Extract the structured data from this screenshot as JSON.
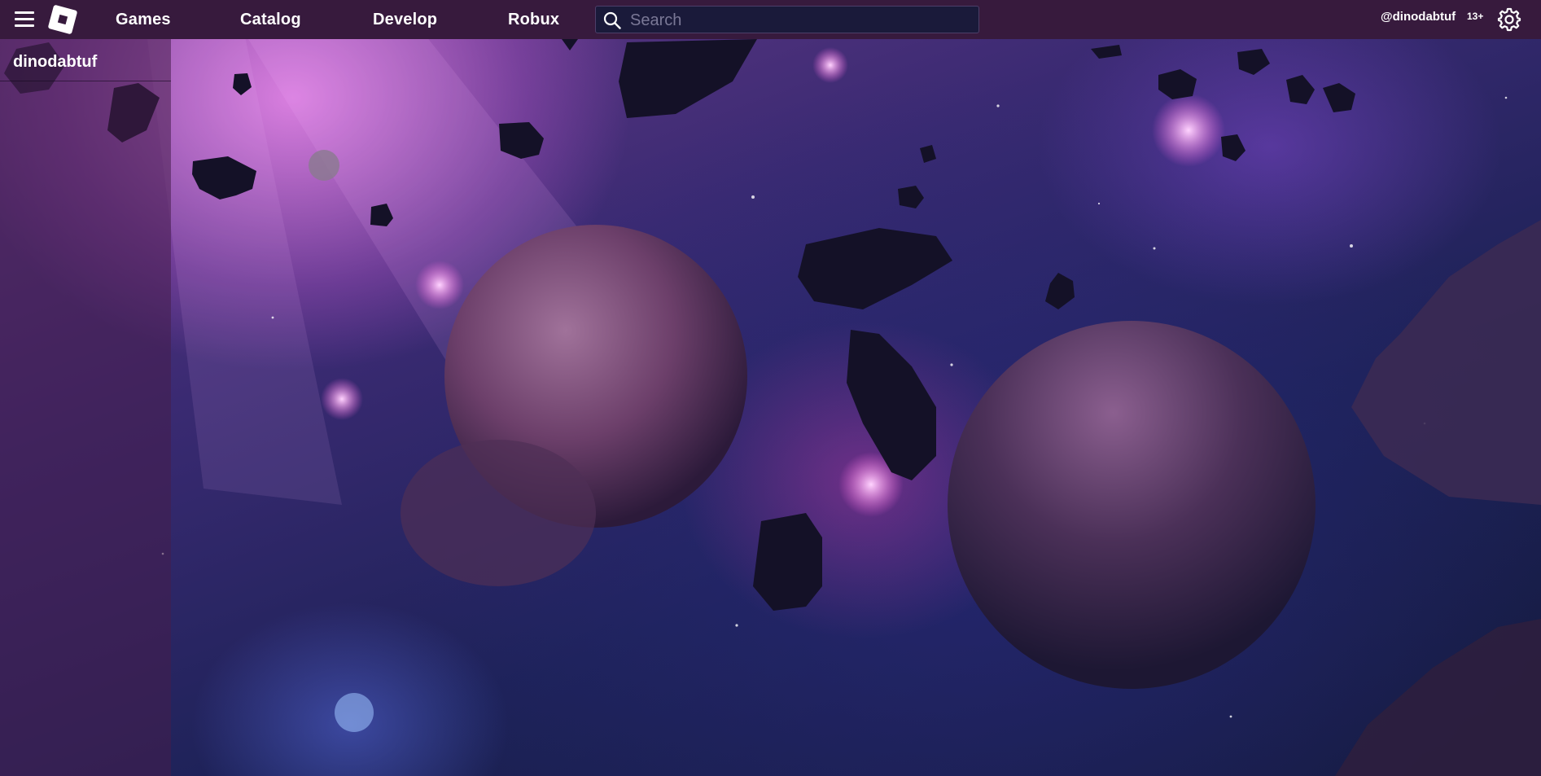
{
  "nav": {
    "games_label": "Games",
    "catalog_label": "Catalog",
    "develop_label": "Develop",
    "robux_label": "Robux"
  },
  "search": {
    "placeholder": "Search"
  },
  "account": {
    "username_handle": "@dinodabtuf",
    "age_badge": "13+"
  },
  "sidebar": {
    "username": "dinodabtuf"
  },
  "icons": {
    "menu": "menu-icon",
    "logo": "logo-icon",
    "search": "search-icon",
    "settings": "gear-icon"
  },
  "colors": {
    "topbar": "#371a3d",
    "sidebar": "#461e4b",
    "search_bg": "#1a1a3a"
  }
}
